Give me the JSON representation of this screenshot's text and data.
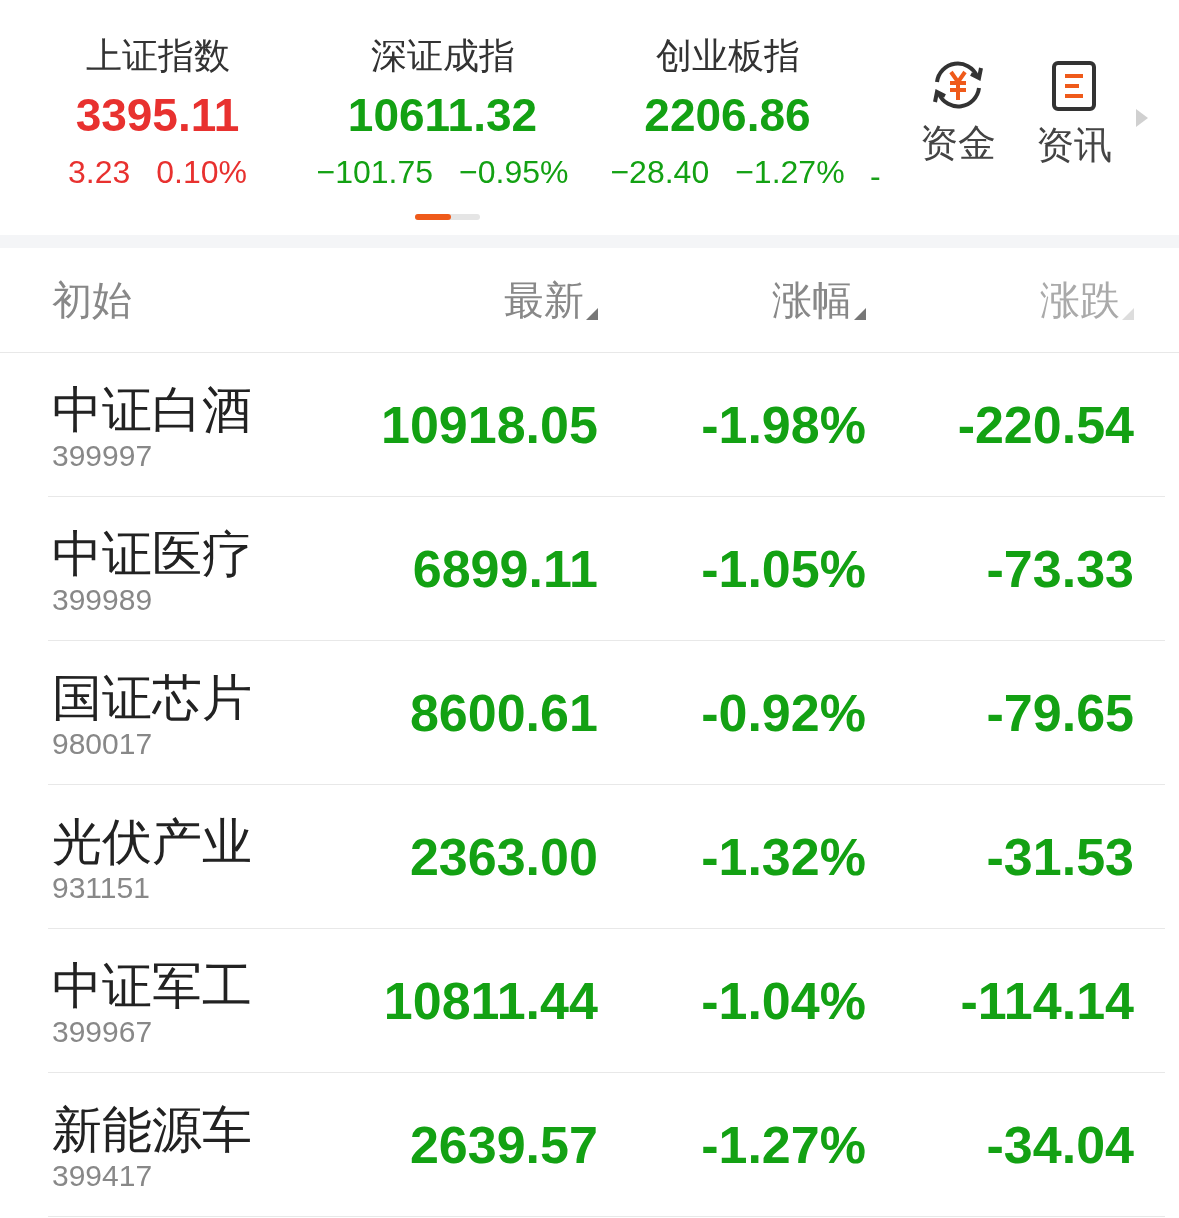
{
  "indices": [
    {
      "name": "上证指数",
      "value": "3395.11",
      "change": "3.23",
      "percent": "0.10%",
      "color": "#e8312f"
    },
    {
      "name": "深证成指",
      "value": "10611.32",
      "change": "−101.75",
      "percent": "−0.95%",
      "color": "#13a113"
    },
    {
      "name": "创业板指",
      "value": "2206.86",
      "change": "−28.40",
      "percent": "−1.27%",
      "color": "#13a113"
    }
  ],
  "next_index_change": "-",
  "shortcuts": [
    {
      "kind": "funds",
      "label": "资金"
    },
    {
      "kind": "news",
      "label": "资讯"
    }
  ],
  "pager": {
    "level": 0.55
  },
  "table": {
    "columns": [
      {
        "label": "初始",
        "sortable": false
      },
      {
        "label": "最新",
        "sortable": true
      },
      {
        "label": "涨幅",
        "sortable": true
      },
      {
        "label": "涨跌",
        "sortable": true
      }
    ],
    "rows": [
      {
        "name": "中证白酒",
        "code": "399997",
        "latest": "10918.05",
        "percent": "-1.98%",
        "change": "-220.54",
        "color": "#13a113"
      },
      {
        "name": "中证医疗",
        "code": "399989",
        "latest": "6899.11",
        "percent": "-1.05%",
        "change": "-73.33",
        "color": "#13a113"
      },
      {
        "name": "国证芯片",
        "code": "980017",
        "latest": "8600.61",
        "percent": "-0.92%",
        "change": "-79.65",
        "color": "#13a113"
      },
      {
        "name": "光伏产业",
        "code": "931151",
        "latest": "2363.00",
        "percent": "-1.32%",
        "change": "-31.53",
        "color": "#13a113"
      },
      {
        "name": "中证军工",
        "code": "399967",
        "latest": "10811.44",
        "percent": "-1.04%",
        "change": "-114.14",
        "color": "#13a113"
      },
      {
        "name": "新能源车",
        "code": "399417",
        "latest": "2639.57",
        "percent": "-1.27%",
        "change": "-34.04",
        "color": "#13a113"
      }
    ]
  }
}
